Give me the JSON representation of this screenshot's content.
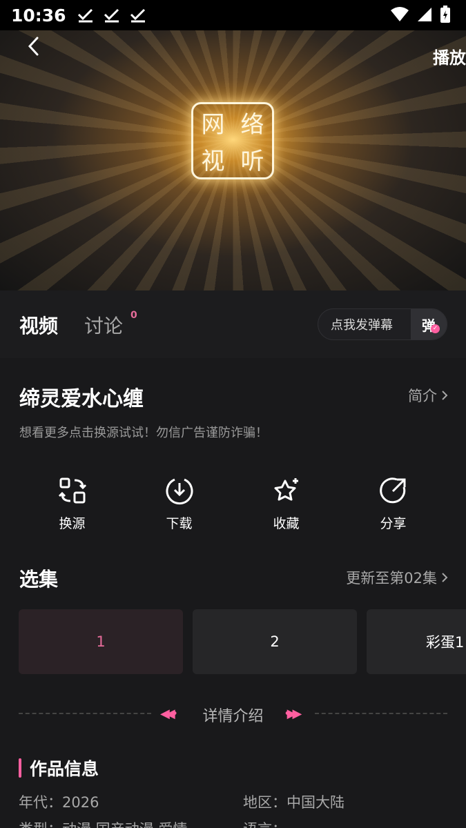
{
  "status_bar": {
    "time": "10:36",
    "icons": [
      "check-icon",
      "check-icon",
      "check-icon",
      "wifi-icon",
      "signal-icon",
      "battery-icon"
    ]
  },
  "player": {
    "logo_chars": [
      "网",
      "络",
      "视",
      "听"
    ],
    "play_label": "播放",
    "back_icon": "chevron-left-icon"
  },
  "tabs": {
    "video": "视频",
    "discuss": "讨论",
    "discuss_count": "0",
    "danmu_placeholder": "点我发弹幕",
    "danmu_toggle": "弹"
  },
  "show": {
    "title": "缔灵爱水心缠",
    "intro_link": "简介",
    "notice": "想看更多点击换源试试！勿信广告谨防诈骗！"
  },
  "actions": [
    {
      "label": "换源",
      "icon": "switch-source-icon"
    },
    {
      "label": "下载",
      "icon": "download-icon"
    },
    {
      "label": "收藏",
      "icon": "star-icon"
    },
    {
      "label": "分享",
      "icon": "share-icon"
    }
  ],
  "episodes": {
    "title": "选集",
    "update_text": "更新至第02集",
    "items": [
      "1",
      "2",
      "彩蛋1"
    ],
    "selected": "1"
  },
  "details": {
    "divider_text": "详情介绍",
    "section_title": "作品信息",
    "year_label": "年代：",
    "year_value": "2026",
    "region_label": "地区：",
    "region_value": "中国大陆",
    "type_label": "类型：",
    "type_value": "动漫,国产动漫,爱情",
    "language_label": "语言："
  },
  "colors": {
    "background": "#19191b",
    "accent": "#ff5fa0",
    "muted_text": "#a8a8a8"
  }
}
